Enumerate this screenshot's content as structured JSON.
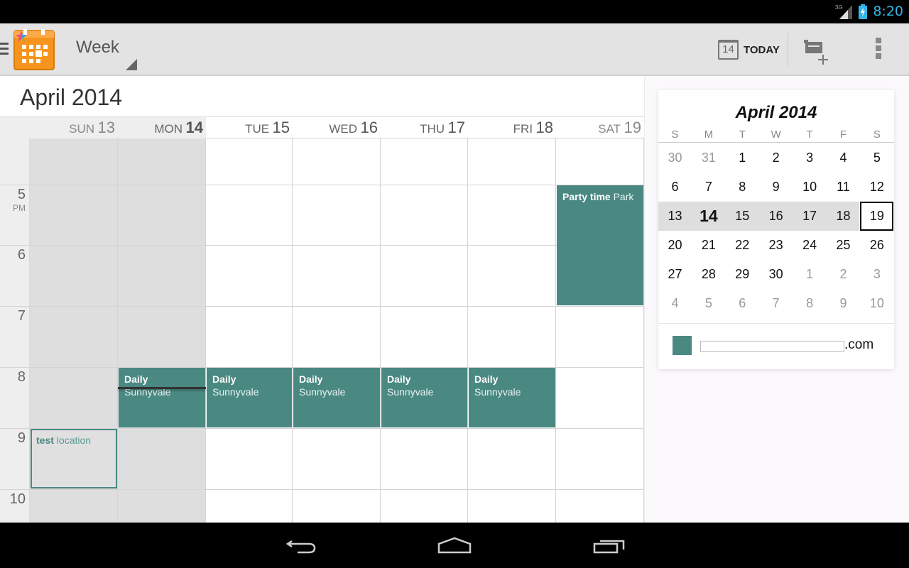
{
  "status_bar": {
    "time": "8:20",
    "network": "3G",
    "icons": [
      "signal-icon",
      "battery-charging-icon"
    ]
  },
  "action_bar": {
    "app_icon": "calendar-app-icon",
    "view_selector": {
      "selected": "Week"
    },
    "today_button": {
      "icon_day": "14",
      "label": "TODAY"
    },
    "new_event_icon": "new-event-icon",
    "overflow_icon": "overflow-menu-icon"
  },
  "main": {
    "month_title": "April 2014",
    "days": [
      {
        "dow": "SUN",
        "num": "13",
        "state": "past"
      },
      {
        "dow": "MON",
        "num": "14",
        "state": "today"
      },
      {
        "dow": "TUE",
        "num": "15",
        "state": "future"
      },
      {
        "dow": "WED",
        "num": "16",
        "state": "future"
      },
      {
        "dow": "THU",
        "num": "17",
        "state": "future"
      },
      {
        "dow": "FRI",
        "num": "18",
        "state": "future"
      },
      {
        "dow": "SAT",
        "num": "19",
        "state": "weekend"
      }
    ],
    "hours": [
      {
        "label": "5",
        "ampm": "PM"
      },
      {
        "label": "6",
        "ampm": ""
      },
      {
        "label": "7",
        "ampm": ""
      },
      {
        "label": "8",
        "ampm": ""
      },
      {
        "label": "9",
        "ampm": ""
      },
      {
        "label": "10",
        "ampm": ""
      }
    ],
    "events": [
      {
        "title": "Party time",
        "location": "Park",
        "day": "SAT 19",
        "start": "5 PM",
        "end": "7 PM",
        "style": "normal"
      },
      {
        "title": "Daily",
        "location": "Sunnyvale",
        "day": "MON 14",
        "start": "8 PM",
        "end": "9 PM",
        "style": "normal"
      },
      {
        "title": "Daily",
        "location": "Sunnyvale",
        "day": "TUE 15",
        "start": "8 PM",
        "end": "9 PM",
        "style": "normal"
      },
      {
        "title": "Daily",
        "location": "Sunnyvale",
        "day": "WED 16",
        "start": "8 PM",
        "end": "9 PM",
        "style": "normal"
      },
      {
        "title": "Daily",
        "location": "Sunnyvale",
        "day": "THU 17",
        "start": "8 PM",
        "end": "9 PM",
        "style": "normal"
      },
      {
        "title": "Daily",
        "location": "Sunnyvale",
        "day": "FRI 18",
        "start": "8 PM",
        "end": "9 PM",
        "style": "normal"
      },
      {
        "title": "test",
        "location": "location",
        "day": "SUN 13",
        "start": "9 PM",
        "end": "10 PM",
        "style": "outlined"
      }
    ],
    "current_time_day": "MON 14",
    "event_color": "#4a8982"
  },
  "mini_month": {
    "title": "April 2014",
    "dow": [
      "S",
      "M",
      "T",
      "W",
      "T",
      "F",
      "S"
    ],
    "weeks": [
      [
        {
          "d": "30",
          "o": true
        },
        {
          "d": "31",
          "o": true
        },
        {
          "d": "1"
        },
        {
          "d": "2"
        },
        {
          "d": "3"
        },
        {
          "d": "4"
        },
        {
          "d": "5"
        }
      ],
      [
        {
          "d": "6"
        },
        {
          "d": "7"
        },
        {
          "d": "8"
        },
        {
          "d": "9"
        },
        {
          "d": "10"
        },
        {
          "d": "11"
        },
        {
          "d": "12"
        }
      ],
      [
        {
          "d": "13"
        },
        {
          "d": "14",
          "today": true
        },
        {
          "d": "15"
        },
        {
          "d": "16"
        },
        {
          "d": "17"
        },
        {
          "d": "18"
        },
        {
          "d": "19",
          "selected": true
        }
      ],
      [
        {
          "d": "20"
        },
        {
          "d": "21"
        },
        {
          "d": "22"
        },
        {
          "d": "23"
        },
        {
          "d": "24"
        },
        {
          "d": "25"
        },
        {
          "d": "26"
        }
      ],
      [
        {
          "d": "27"
        },
        {
          "d": "28"
        },
        {
          "d": "29"
        },
        {
          "d": "30"
        },
        {
          "d": "1",
          "o": true
        },
        {
          "d": "2",
          "o": true
        },
        {
          "d": "3",
          "o": true
        }
      ],
      [
        {
          "d": "4",
          "o": true
        },
        {
          "d": "5",
          "o": true
        },
        {
          "d": "6",
          "o": true
        },
        {
          "d": "7",
          "o": true
        },
        {
          "d": "8",
          "o": true
        },
        {
          "d": "9",
          "o": true
        },
        {
          "d": "10",
          "o": true
        }
      ]
    ],
    "current_week_index": 2
  },
  "calendar_account": {
    "visible_suffix": ".com",
    "redacted": true,
    "color": "#4a8982"
  },
  "nav_bar": {
    "buttons": [
      "back-icon",
      "home-icon",
      "recent-apps-icon"
    ]
  }
}
